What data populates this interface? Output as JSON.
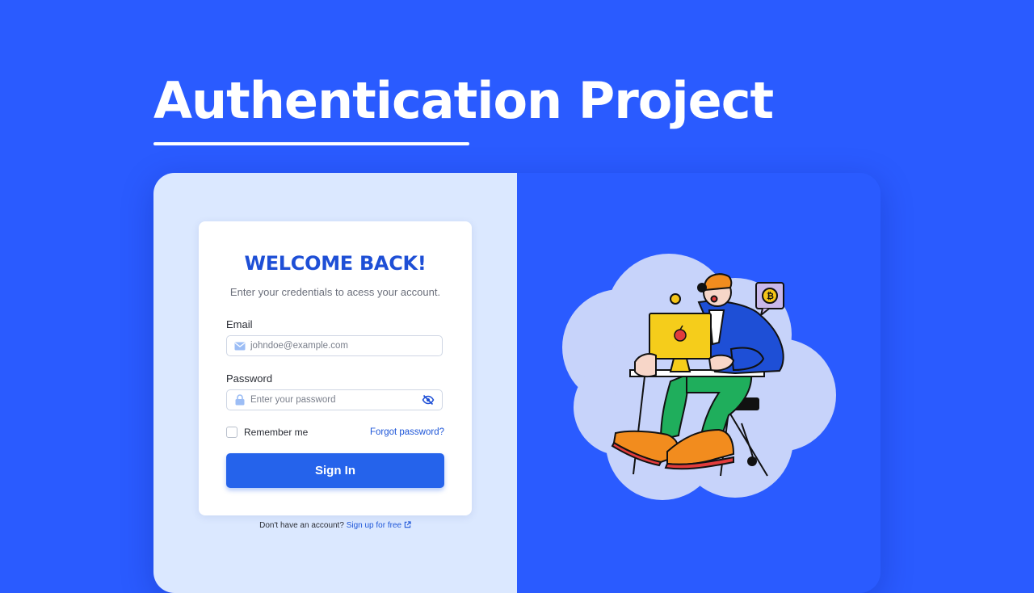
{
  "page": {
    "title": "Authentication Project"
  },
  "login": {
    "heading": "WELCOME BACK!",
    "subtitle": "Enter your credentials to acess your account.",
    "email_label": "Email",
    "email_placeholder": "johndoe@example.com",
    "password_label": "Password",
    "password_placeholder": "Enter your password",
    "remember_label": "Remember me",
    "forgot_label": "Forgot password?",
    "signin_label": "Sign In",
    "signup_prompt": "Don't have an account?",
    "signup_link": "Sign up for free"
  },
  "icons": {
    "email": "envelope-icon",
    "password": "lock-icon",
    "toggle": "eye-off-icon",
    "external": "external-link-icon"
  },
  "colors": {
    "background": "#2a5bff",
    "left_panel": "#dbe8ff",
    "accent": "#2563eb",
    "heading": "#1e4fd6"
  }
}
